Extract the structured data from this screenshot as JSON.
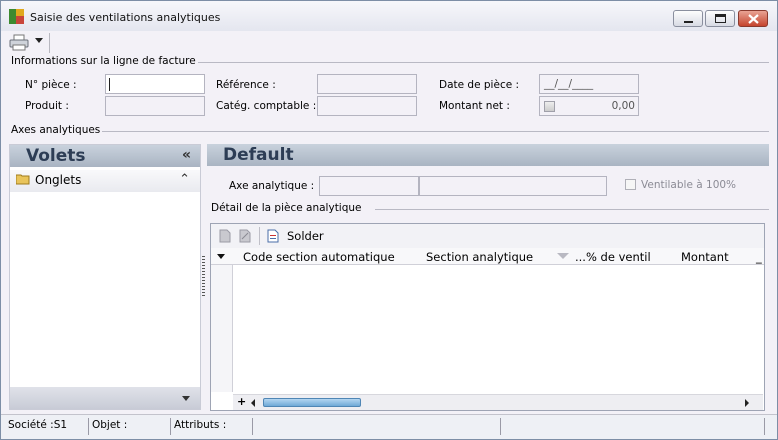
{
  "window": {
    "title": "Saisie des ventilations analytiques"
  },
  "invoice_group": {
    "title": "Informations sur la ligne de facture",
    "num_piece_label": "N° pièce :",
    "num_piece_value": "",
    "reference_label": "Référence :",
    "reference_value": "",
    "date_label": "Date de pièce :",
    "date_value": "__/__/____",
    "produit_label": "Produit :",
    "produit_value": "",
    "categ_label": "Catég. comptable :",
    "categ_value": "",
    "montant_label": "Montant net :",
    "montant_value": "0,00"
  },
  "axes_group": {
    "title": "Axes analytiques"
  },
  "left_panel": {
    "header": "Volets",
    "tab_label": "Onglets"
  },
  "right_panel": {
    "header": "Default",
    "axe_label": "Axe analytique :",
    "axe_code": "",
    "axe_name": "",
    "ventilable_label": "Ventilable à 100%",
    "detail_title": "Détail de la pièce analytique",
    "solder_label": "Solder",
    "columns": [
      "Code section automatique",
      "Section analytique",
      "...% de ventil",
      "Montant",
      "_"
    ]
  },
  "statusbar": {
    "societe": "Société :S1",
    "objet": "Objet :",
    "attributs": "Attributs :"
  },
  "icons": {
    "app": "app-icon",
    "print": "printer-icon",
    "folder": "folder-icon",
    "solder": "document-icon"
  }
}
